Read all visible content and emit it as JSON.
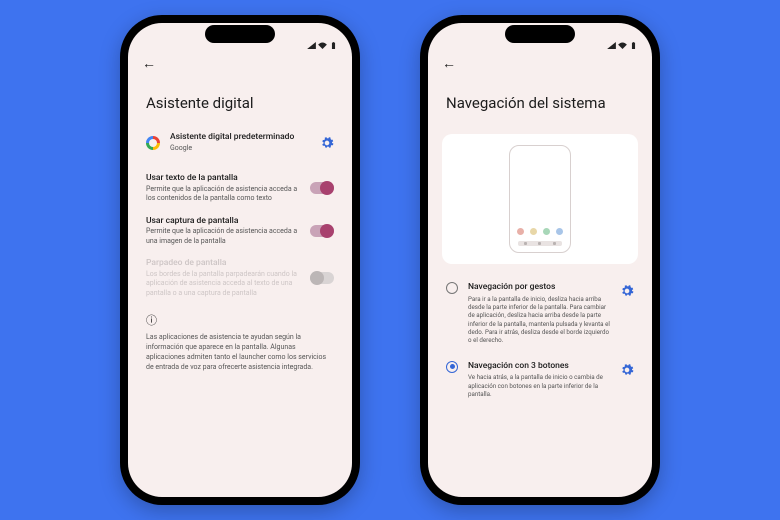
{
  "statusbar": {
    "signal": "▲",
    "wifi": "▲",
    "battery": "▮"
  },
  "left": {
    "title": "Asistente digital",
    "default": {
      "label": "Asistente digital predeterminado",
      "sub": "Google"
    },
    "useText": {
      "label": "Usar texto de la pantalla",
      "sub": "Permite que la aplicación de asistencia acceda a los contenidos de la pantalla como texto",
      "on": true
    },
    "useCapture": {
      "label": "Usar captura de pantalla",
      "sub": "Permite que la aplicación de asistencia acceda a una imagen de la pantalla",
      "on": true
    },
    "flash": {
      "label": "Parpadeo de pantalla",
      "sub": "Los bordes de la pantalla parpadearán cuando la aplicación de asistencia acceda al texto de una pantalla o a una captura de pantalla",
      "on": false
    },
    "info": "Las aplicaciones de asistencia te ayudan según la información que aparece en la pantalla. Algunas aplicaciones admiten tanto el launcher como los servicios de entrada de voz para ofrecerte asistencia integrada."
  },
  "right": {
    "title": "Navegación del sistema",
    "gesture": {
      "label": "Navegación por gestos",
      "sub": "Para ir a la pantalla de inicio, desliza hacia arriba desde la parte inferior de la pantalla. Para cambiar de aplicación, desliza hacia arriba desde la parte inferior de la pantalla, mantenla pulsada y levanta el dedo. Para ir atrás, desliza desde el borde izquierdo o el derecho.",
      "selected": false
    },
    "threeButton": {
      "label": "Navegación con 3 botones",
      "sub": "Ve hacia atrás, a la pantalla de inicio o cambia de aplicación con botones en la parte inferior de la pantalla.",
      "selected": true
    }
  }
}
